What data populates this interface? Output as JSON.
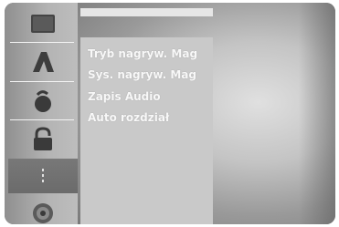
{
  "sidebar": {
    "items": [
      {
        "icon": "disc-box-icon"
      },
      {
        "icon": "language-a-icon"
      },
      {
        "icon": "audio-icon"
      },
      {
        "icon": "padlock-icon"
      },
      {
        "icon": "record-dots-icon",
        "active": true
      },
      {
        "icon": "disc-icon"
      }
    ]
  },
  "menu": {
    "items": [
      {
        "label": "Tryb nagryw. Mag"
      },
      {
        "label": "Sys. nagryw. Mag"
      },
      {
        "label": "Zapis Audio"
      },
      {
        "label": "Auto rozdział"
      }
    ]
  },
  "colors": {
    "active_item": "#6b6b6b",
    "menu_text": "#f8f8f8",
    "menu_panel": "#c9c9c9"
  }
}
